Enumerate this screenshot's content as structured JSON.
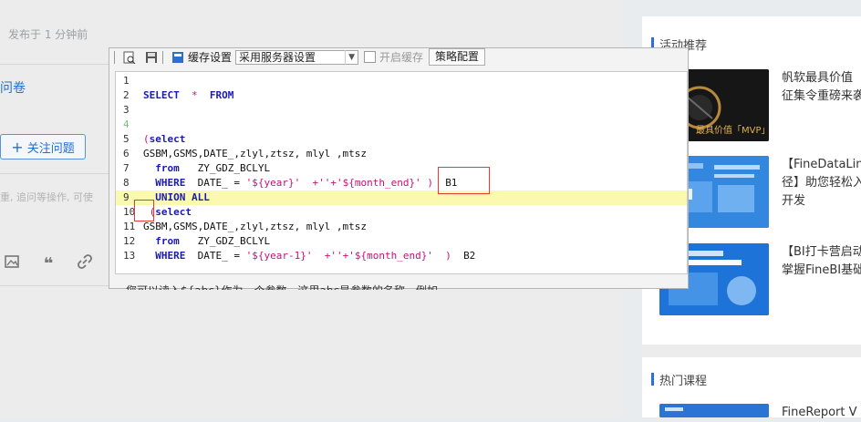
{
  "left": {
    "meta": "发布于 1 分钟前",
    "question_link": "问卷",
    "follow_button": "关注问题",
    "hint": "重, 追问等操作, 可使"
  },
  "dialog": {
    "cache_setting_label": "缓存设置",
    "cache_select_value": "采用服务器设置",
    "enable_cache_label": "开启缓存",
    "policy_button": "策略配置",
    "bottom_text": "您可以读入${abc}作为一个参数，这里abc是参数的名称，例如"
  },
  "code_lines": [
    {
      "n": "1"
    },
    {
      "n": "2"
    },
    {
      "n": "3"
    },
    {
      "n": "4"
    },
    {
      "n": "5"
    },
    {
      "n": "6"
    },
    {
      "n": "7"
    },
    {
      "n": "8"
    },
    {
      "n": "9"
    },
    {
      "n": "10"
    },
    {
      "n": "11"
    },
    {
      "n": "12"
    },
    {
      "n": "13"
    }
  ],
  "code": {
    "l2_select": "SELECT",
    "l2_star": "*",
    "l2_from": "FROM",
    "l5_paren": "(",
    "l5_select": "select",
    "l6": "GSBM,GSMS,DATE_,zlyl,ztsz, mlyl ,mtsz",
    "l7_from": "from",
    "l7_rest": "ZY_GDZ_BCLYL",
    "l8_where": "WHERE",
    "l8_date": "DATE_ =",
    "l8_str1": "'${year}'",
    "l8_plus": "+''+",
    "l8_str2": "'${month_end}'",
    "l8_paren": ")",
    "l8_alias": "B1",
    "l9": "UNION ALL",
    "l10_paren": "(",
    "l10_select": "select",
    "l11": "GSBM,GSMS,DATE_,zlyl,ztsz, mlyl ,mtsz",
    "l12_from": "from",
    "l12_rest": "ZY_GDZ_BCLYL",
    "l13_where": "WHERE",
    "l13_date": "DATE_ =",
    "l13_str1": "'${year-1}'",
    "l13_plus": "+''+",
    "l13_str2": "'${month_end}'",
    "l13_paren": ")",
    "l13_alias": "B2"
  },
  "right": {
    "activity_title": "活动推荐",
    "card1_line1": "帆软最具价值",
    "card1_line2": "征集令重磅来袭",
    "card2_line1": "【FineDataLink",
    "card2_line2": "径】助您轻松入",
    "card2_line3": "开发",
    "card3_line1": "【BI打卡营启动",
    "card3_line2": "掌握FineBI基础",
    "courses_title": "热门课程",
    "course1": "FineReport V"
  }
}
